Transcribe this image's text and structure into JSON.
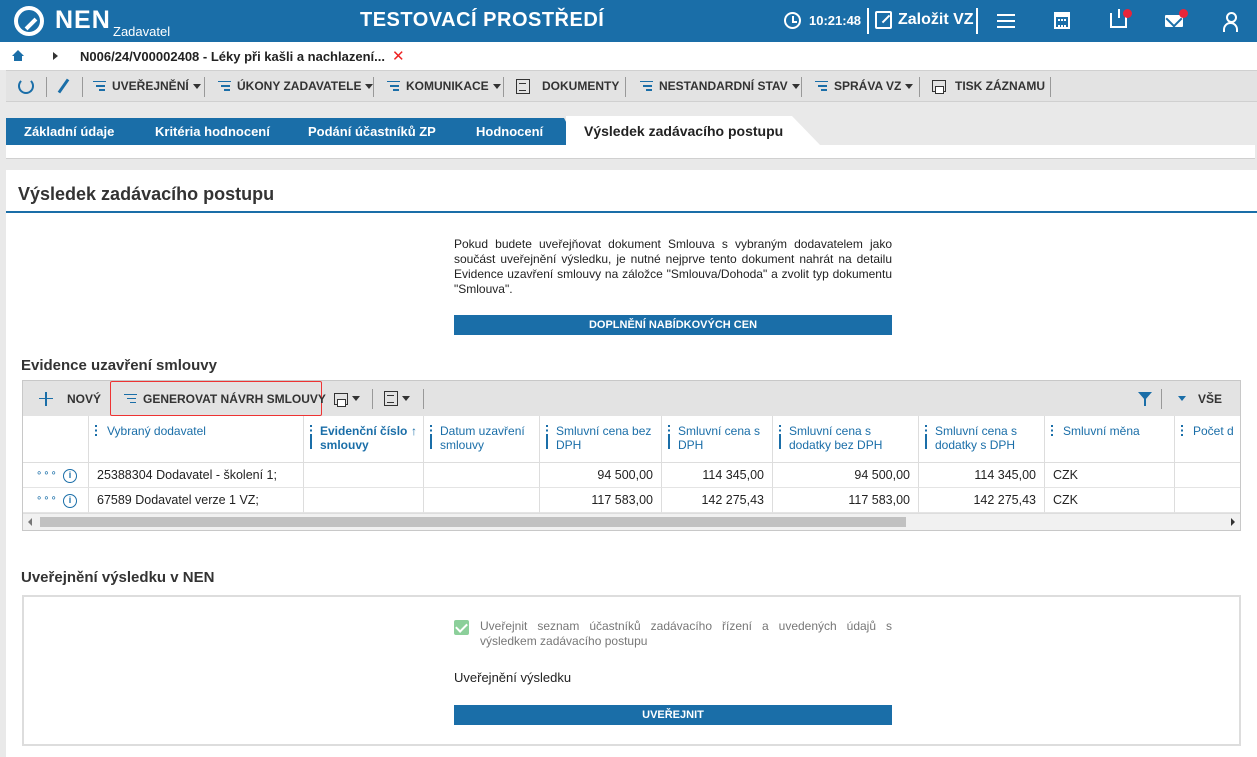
{
  "topbar": {
    "logo": "NEN",
    "logo_sub": "Zadavatel",
    "environment": "TESTOVACÍ PROSTŘEDÍ",
    "time": "10:21:48",
    "create_label": "Založit VZ"
  },
  "breadcrumb": {
    "text": "N006/24/V00002408 - Léky při kašli a nachlazení...",
    "close": "✕"
  },
  "toolbar": {
    "items": [
      "UVEŘEJNĚNÍ",
      "ÚKONY ZADAVATELE",
      "KOMUNIKACE",
      "DOKUMENTY",
      "NESTANDARDNÍ STAV",
      "SPRÁVA VZ",
      "TISK ZÁZNAMU"
    ]
  },
  "tabs": {
    "items": [
      "Základní údaje",
      "Kritéria hodnocení",
      "Podání účastníků ZP",
      "Hodnocení"
    ],
    "active": "Výsledek zadávacího postupu"
  },
  "main": {
    "title": "Výsledek zadávacího postupu",
    "notice": "Pokud budete uveřejňovat dokument Smlouva s vybraným dodavatelem jako součást uveřejnění výsledku, je nutné nejprve tento dokument nahrát na detailu Evidence uzavření smlouvy na záložce \"Smlouva/Dohoda\" a zvolit typ dokumentu \"Smlouva\".",
    "prices_button": "DOPLNĚNÍ NABÍDKOVÝCH CEN"
  },
  "contracts": {
    "title": "Evidence uzavření smlouvy",
    "new_label": "NOVÝ",
    "generate_label": "GENEROVAT NÁVRH SMLOUVY",
    "all_label": "VŠE",
    "columns": [
      "Vybraný dodavatel",
      "Evidenční číslo smlouvy",
      "Datum uzavření smlouvy",
      "Smluvní cena bez DPH",
      "Smluvní cena s DPH",
      "Smluvní cena s dodatky bez DPH",
      "Smluvní cena s dodatky s DPH",
      "Smluvní měna",
      "Počet d"
    ],
    "sort_indicator": "↑",
    "row_dots": "∘∘∘",
    "info_glyph": "i",
    "rows": [
      [
        "25388304 Dodavatel - školení 1;",
        "",
        "",
        "94 500,00",
        "114 345,00",
        "94 500,00",
        "114 345,00",
        "CZK",
        ""
      ],
      [
        "67589 Dodavatel verze 1 VZ;",
        "",
        "",
        "117 583,00",
        "142 275,43",
        "117 583,00",
        "142 275,43",
        "CZK",
        ""
      ]
    ]
  },
  "publish": {
    "title": "Uveřejnění výsledku v NEN",
    "checkbox_label": "Uveřejnit seznam účastníků zadávacího řízení a uvedených údajů s výsledkem zadávacího postupu",
    "checkbox_checked": true,
    "section_label": "Uveřejnění výsledku",
    "button": "UVEŘEJNIT"
  },
  "colors": {
    "brand": "#1a6ea8",
    "notification": "#e8253a",
    "highlight": "#e33333",
    "check": "#8ccf9a"
  },
  "icons": [
    "nen-logo-icon",
    "clock-icon",
    "create-pencil-icon",
    "menu-icon",
    "calculator-icon",
    "inbox-icon",
    "mail-icon",
    "user-icon",
    "home-icon",
    "refresh-icon",
    "edit-icon",
    "document-icon",
    "print-icon",
    "plus-icon",
    "filter-icon",
    "info-icon"
  ]
}
